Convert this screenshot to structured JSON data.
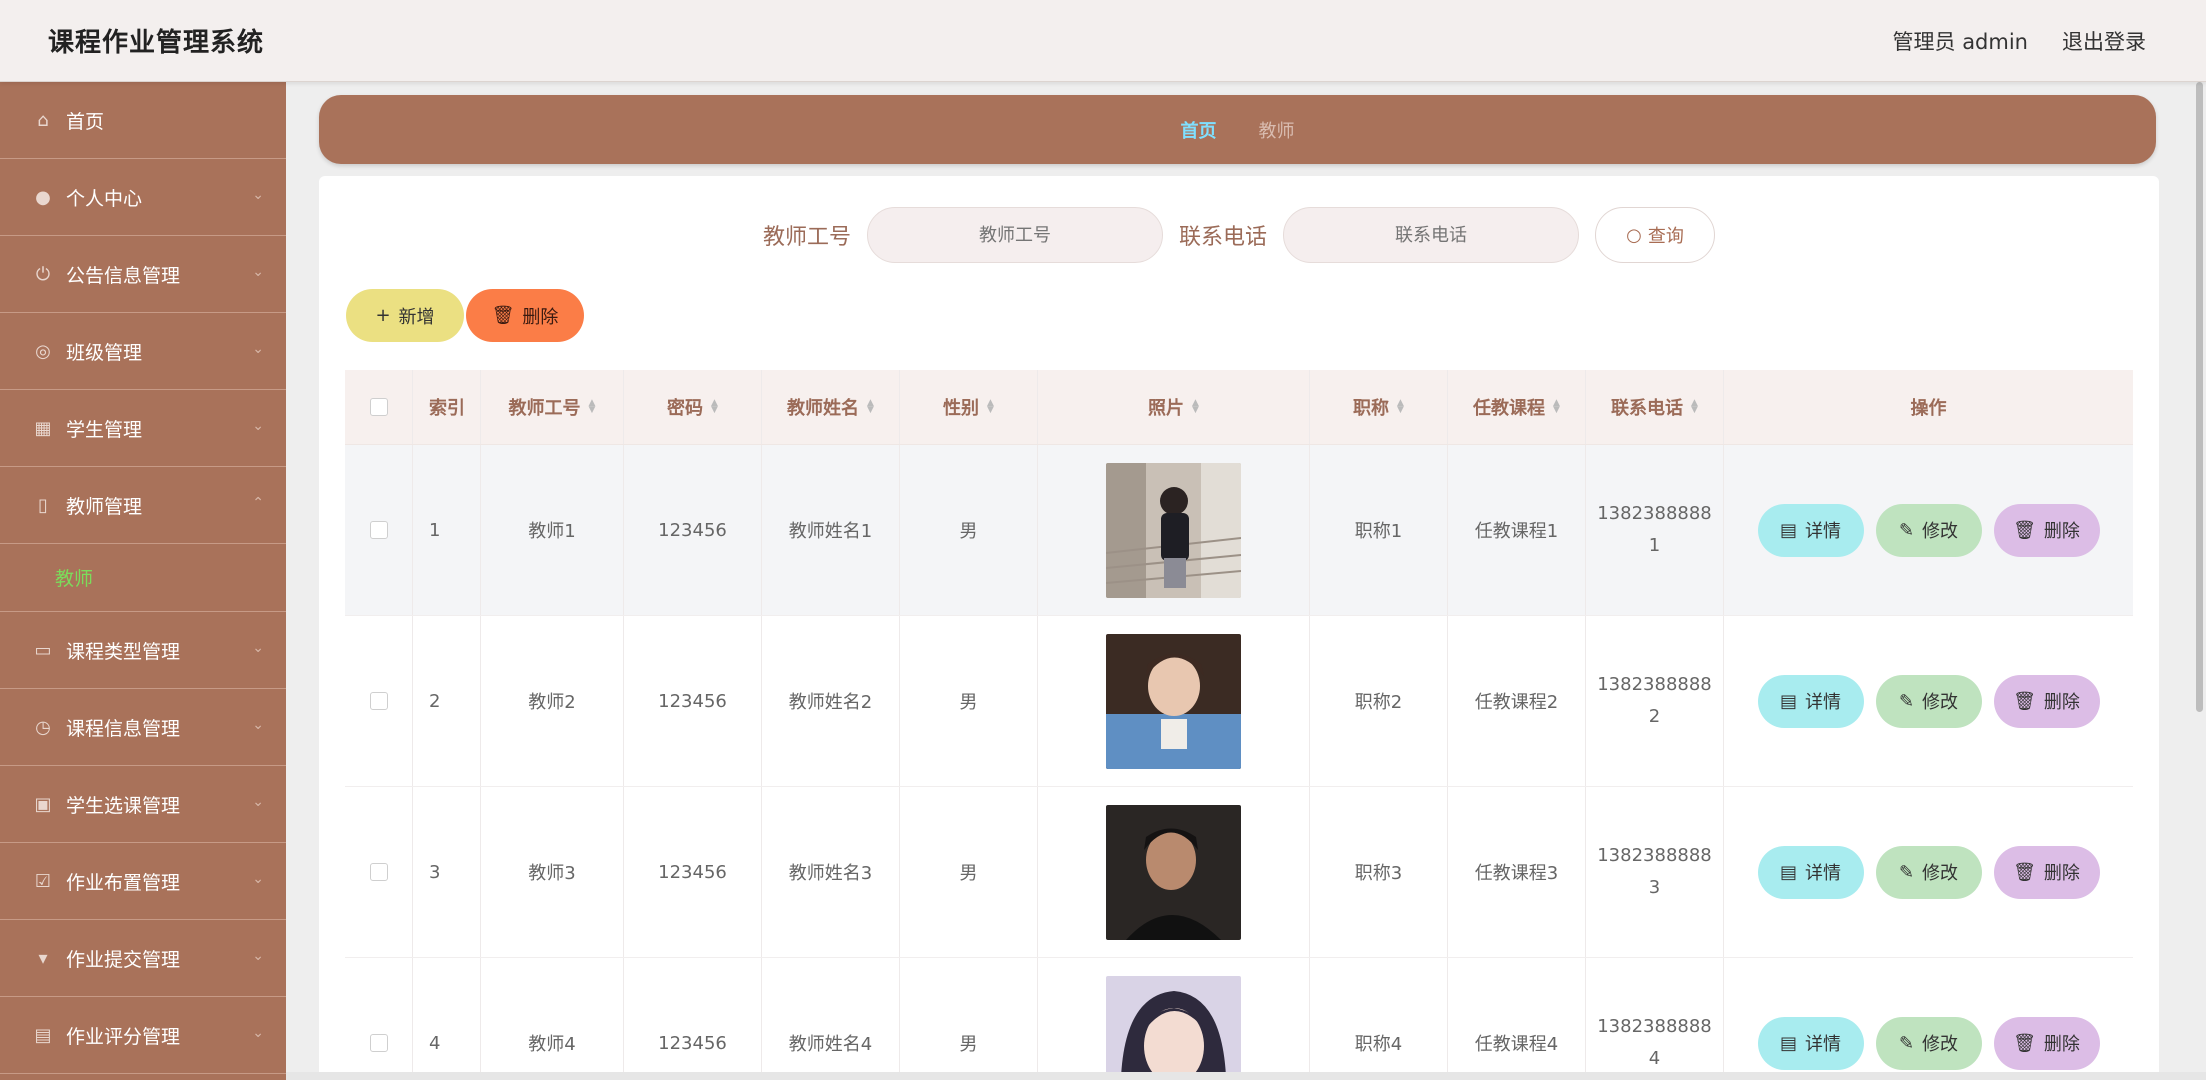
{
  "header": {
    "title": "课程作业管理系统",
    "user": "管理员 admin",
    "logout": "退出登录"
  },
  "sidebar": {
    "items": [
      {
        "label": "首页",
        "icon": "home-icon"
      },
      {
        "label": "个人中心",
        "icon": "user-icon"
      },
      {
        "label": "公告信息管理",
        "icon": "power-icon"
      },
      {
        "label": "班级管理",
        "icon": "circle-icon"
      },
      {
        "label": "学生管理",
        "icon": "grid-icon"
      },
      {
        "label": "教师管理",
        "icon": "phone-icon",
        "expanded": true
      },
      {
        "label": "课程类型管理",
        "icon": "monitor-icon"
      },
      {
        "label": "课程信息管理",
        "icon": "clock-icon"
      },
      {
        "label": "学生选课管理",
        "icon": "image-icon"
      },
      {
        "label": "作业布置管理",
        "icon": "check-icon"
      },
      {
        "label": "作业提交管理",
        "icon": "pin-icon"
      },
      {
        "label": "作业评分管理",
        "icon": "briefcase-icon"
      }
    ],
    "submenu": "教师"
  },
  "breadcrumb": {
    "home": "首页",
    "current": "教师"
  },
  "search": {
    "label1": "教师工号",
    "placeholder1": "教师工号",
    "label2": "联系电话",
    "placeholder2": "联系电话",
    "button": "查询"
  },
  "actions": {
    "add": "新增",
    "delete": "删除"
  },
  "table": {
    "headers": [
      "索引",
      "教师工号",
      "密码",
      "教师姓名",
      "性别",
      "照片",
      "职称",
      "任教课程",
      "联系电话",
      "操作"
    ],
    "rows": [
      {
        "index": "1",
        "id": "教师1",
        "password": "123456",
        "name": "教师姓名1",
        "gender": "男",
        "title": "职称1",
        "course": "任教课程1",
        "phone_a": "1382388888",
        "phone_b": "1"
      },
      {
        "index": "2",
        "id": "教师2",
        "password": "123456",
        "name": "教师姓名2",
        "gender": "男",
        "title": "职称2",
        "course": "任教课程2",
        "phone_a": "1382388888",
        "phone_b": "2"
      },
      {
        "index": "3",
        "id": "教师3",
        "password": "123456",
        "name": "教师姓名3",
        "gender": "男",
        "title": "职称3",
        "course": "任教课程3",
        "phone_a": "1382388888",
        "phone_b": "3"
      },
      {
        "index": "4",
        "id": "教师4",
        "password": "123456",
        "name": "教师姓名4",
        "gender": "男",
        "title": "职称4",
        "course": "任教课程4",
        "phone_a": "1382388888",
        "phone_b": "4"
      }
    ],
    "ops": {
      "detail": "详情",
      "edit": "修改",
      "remove": "删除"
    }
  },
  "colors": {
    "sidebar": "#a9725a",
    "accent_add": "#ebe082",
    "accent_delete": "#fb7d47",
    "op_detail": "#a8ecef",
    "op_edit": "#bfe3bf",
    "op_remove": "#dcbde6"
  }
}
